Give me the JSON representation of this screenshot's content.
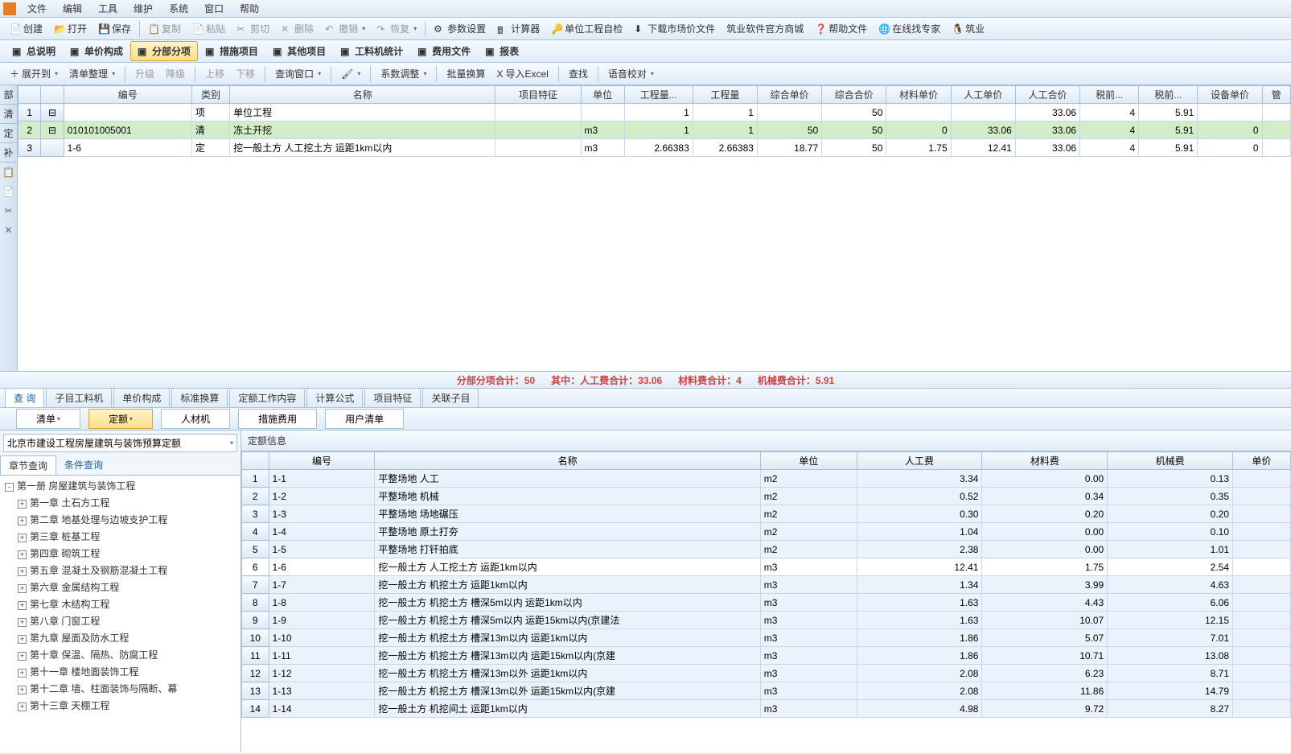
{
  "menu": [
    "文件",
    "编辑",
    "工具",
    "维护",
    "系统",
    "窗口",
    "帮助"
  ],
  "toolbar1": [
    {
      "label": "创建",
      "icon": "new"
    },
    {
      "label": "打开",
      "icon": "open"
    },
    {
      "label": "保存",
      "icon": "save"
    },
    {
      "sep": true
    },
    {
      "label": "复制",
      "icon": "copy",
      "disabled": true
    },
    {
      "label": "粘贴",
      "icon": "paste",
      "disabled": true
    },
    {
      "label": "剪切",
      "icon": "cut",
      "disabled": true
    },
    {
      "label": "删除",
      "icon": "del",
      "disabled": true
    },
    {
      "label": "撤销",
      "icon": "undo",
      "disabled": true,
      "dd": true
    },
    {
      "label": "恢复",
      "icon": "redo",
      "disabled": true,
      "dd": true
    },
    {
      "sep": true
    },
    {
      "label": "参数设置",
      "icon": "cfg"
    },
    {
      "label": "计算器",
      "icon": "calc"
    },
    {
      "label": "单位工程自检",
      "icon": "check"
    },
    {
      "label": "下载市场价文件",
      "icon": "dl"
    },
    {
      "label": "筑业软件官方商城"
    },
    {
      "label": "帮助文件",
      "icon": "help"
    },
    {
      "label": "在线找专家",
      "icon": "expert"
    },
    {
      "label": "筑业",
      "icon": "qq"
    }
  ],
  "tabs": [
    {
      "label": "总说明"
    },
    {
      "label": "单价构成"
    },
    {
      "label": "分部分项",
      "active": true
    },
    {
      "label": "措施项目"
    },
    {
      "label": "其他项目"
    },
    {
      "label": "工料机统计"
    },
    {
      "label": "费用文件"
    },
    {
      "label": "报表"
    }
  ],
  "subtoolbar": [
    {
      "label": "展开到",
      "icon": "plus",
      "dd": true
    },
    {
      "label": "清单整理",
      "dd": true
    },
    {
      "sep": true
    },
    {
      "label": "升级",
      "disabled": true
    },
    {
      "label": "降级",
      "disabled": true
    },
    {
      "sep": true
    },
    {
      "label": "上移",
      "disabled": true
    },
    {
      "label": "下移",
      "disabled": true
    },
    {
      "sep": true
    },
    {
      "label": "查询窗口",
      "dd": true
    },
    {
      "sep": true
    },
    {
      "label": "",
      "icon": "brush",
      "dd": true
    },
    {
      "sep": true
    },
    {
      "label": "系数调整",
      "dd": true
    },
    {
      "sep": true
    },
    {
      "label": "批量换算"
    },
    {
      "label": "导入Excel",
      "icon": "excel"
    },
    {
      "sep": true
    },
    {
      "label": "查找"
    },
    {
      "sep": true
    },
    {
      "label": "语音校对",
      "dd": true
    }
  ],
  "side_tabs": [
    "部",
    "清",
    "定",
    "补"
  ],
  "grid": {
    "headers": [
      "",
      "",
      "编号",
      "类别",
      "名称",
      "项目特征",
      "单位",
      "工程量...",
      "工程量",
      "综合单价",
      "综合合价",
      "材料单价",
      "人工单价",
      "人工合价",
      "税前...",
      "税前...",
      "设备单价",
      "管"
    ],
    "rows": [
      {
        "n": "1",
        "exp": "-",
        "code": "",
        "cat": "项",
        "name": "单位工程",
        "feat": "",
        "unit": "",
        "q1": "1",
        "q2": "1",
        "up": "",
        "hp": "50",
        "mp": "",
        "lp": "",
        "lh": "33.06",
        "t1": "4",
        "t2": "5.91",
        "ep": ""
      },
      {
        "n": "2",
        "exp": "-",
        "code": "010101005001",
        "cat": "清",
        "name": "冻土开挖",
        "feat": "",
        "unit": "m3",
        "q1": "1",
        "q2": "1",
        "up": "50",
        "hp": "50",
        "mp": "0",
        "lp": "33.06",
        "lh": "33.06",
        "t1": "4",
        "t2": "5.91",
        "ep": "0",
        "green": true
      },
      {
        "n": "3",
        "exp": "",
        "code": "1-6",
        "cat": "定",
        "name": "挖一般土方  人工挖土方  运距1km以内",
        "feat": "",
        "unit": "m3",
        "q1": "2.66383",
        "q2": "2.66383",
        "up": "18.77",
        "hp": "50",
        "mp": "1.75",
        "lp": "12.41",
        "lh": "33.06",
        "t1": "4",
        "t2": "5.91",
        "ep": "0"
      }
    ]
  },
  "status": {
    "sum": "分部分项合计：50",
    "labor": "其中：人工费合计：33.06",
    "mat": "材料费合计：4",
    "mach": "机械费合计：5.91"
  },
  "bottom_tabs": [
    "查 询",
    "子目工料机",
    "单价构成",
    "标准换算",
    "定额工作内容",
    "计算公式",
    "项目特征",
    "关联子目"
  ],
  "filter_buttons": [
    {
      "label": "清单",
      "dd": true
    },
    {
      "label": "定额",
      "active": true,
      "dd": true
    },
    {
      "label": "人材机"
    },
    {
      "label": "措施费用"
    },
    {
      "label": "用户清单"
    }
  ],
  "left": {
    "combo": "北京市建设工程房屋建筑与装饰预算定额",
    "subtabs": [
      "章节查询",
      "条件查询"
    ],
    "tree": [
      {
        "lvl": 0,
        "exp": "-",
        "label": "第一册  房屋建筑与装饰工程"
      },
      {
        "lvl": 1,
        "exp": "+",
        "label": "第一章  土石方工程"
      },
      {
        "lvl": 1,
        "exp": "+",
        "label": "第二章  地基处理与边坡支护工程"
      },
      {
        "lvl": 1,
        "exp": "+",
        "label": "第三章  桩基工程"
      },
      {
        "lvl": 1,
        "exp": "+",
        "label": "第四章  砌筑工程"
      },
      {
        "lvl": 1,
        "exp": "+",
        "label": "第五章  混凝土及钢筋混凝土工程"
      },
      {
        "lvl": 1,
        "exp": "+",
        "label": "第六章  金属结构工程"
      },
      {
        "lvl": 1,
        "exp": "+",
        "label": "第七章  木结构工程"
      },
      {
        "lvl": 1,
        "exp": "+",
        "label": "第八章  门窗工程"
      },
      {
        "lvl": 1,
        "exp": "+",
        "label": "第九章  屋面及防水工程"
      },
      {
        "lvl": 1,
        "exp": "+",
        "label": "第十章  保温、隔热、防腐工程"
      },
      {
        "lvl": 1,
        "exp": "+",
        "label": "第十一章  楼地面装饰工程"
      },
      {
        "lvl": 1,
        "exp": "+",
        "label": "第十二章  墙、柱面装饰与隔断、幕"
      },
      {
        "lvl": 1,
        "exp": "+",
        "label": "第十三章  天棚工程"
      }
    ]
  },
  "right": {
    "title": "定额信息",
    "headers": [
      "",
      "编号",
      "名称",
      "单位",
      "人工费",
      "材料费",
      "机械费",
      "单价"
    ],
    "rows": [
      {
        "n": "1",
        "code": "1-1",
        "name": "平整场地  人工",
        "unit": "m2",
        "l": "3.34",
        "m": "0.00",
        "j": "0.13",
        "p": ""
      },
      {
        "n": "2",
        "code": "1-2",
        "name": "平整场地  机械",
        "unit": "m2",
        "l": "0.52",
        "m": "0.34",
        "j": "0.35",
        "p": ""
      },
      {
        "n": "3",
        "code": "1-3",
        "name": "平整场地  场地碾压",
        "unit": "m2",
        "l": "0.30",
        "m": "0.20",
        "j": "0.20",
        "p": ""
      },
      {
        "n": "4",
        "code": "1-4",
        "name": "平整场地  原土打夯",
        "unit": "m2",
        "l": "1.04",
        "m": "0.00",
        "j": "0.10",
        "p": ""
      },
      {
        "n": "5",
        "code": "1-5",
        "name": "平整场地  打钎拍底",
        "unit": "m2",
        "l": "2.38",
        "m": "0.00",
        "j": "1.01",
        "p": ""
      },
      {
        "n": "6",
        "code": "1-6",
        "name": "挖一般土方  人工挖土方  运距1km以内",
        "unit": "m3",
        "l": "12.41",
        "m": "1.75",
        "j": "2.54",
        "p": "",
        "sel": true
      },
      {
        "n": "7",
        "code": "1-7",
        "name": "挖一般土方  机挖土方  运距1km以内",
        "unit": "m3",
        "l": "1.34",
        "m": "3.99",
        "j": "4.63",
        "p": ""
      },
      {
        "n": "8",
        "code": "1-8",
        "name": "挖一般土方  机挖土方  槽深5m以内  运距1km以内",
        "unit": "m3",
        "l": "1.63",
        "m": "4.43",
        "j": "6.06",
        "p": ""
      },
      {
        "n": "9",
        "code": "1-9",
        "name": "挖一般土方  机挖土方  槽深5m以内  运距15km以内(京建法",
        "unit": "m3",
        "l": "1.63",
        "m": "10.07",
        "j": "12.15",
        "p": ""
      },
      {
        "n": "10",
        "code": "1-10",
        "name": "挖一般土方  机挖土方  槽深13m以内  运距1km以内",
        "unit": "m3",
        "l": "1.86",
        "m": "5.07",
        "j": "7.01",
        "p": ""
      },
      {
        "n": "11",
        "code": "1-11",
        "name": "挖一般土方  机挖土方  槽深13m以内  运距15km以内(京建",
        "unit": "m3",
        "l": "1.86",
        "m": "10.71",
        "j": "13.08",
        "p": ""
      },
      {
        "n": "12",
        "code": "1-12",
        "name": "挖一般土方  机挖土方  槽深13m以外  运距1km以内",
        "unit": "m3",
        "l": "2.08",
        "m": "6.23",
        "j": "8.71",
        "p": ""
      },
      {
        "n": "13",
        "code": "1-13",
        "name": "挖一般土方  机挖土方  槽深13m以外  运距15km以内(京建",
        "unit": "m3",
        "l": "2.08",
        "m": "11.86",
        "j": "14.79",
        "p": ""
      },
      {
        "n": "14",
        "code": "1-14",
        "name": "挖一般土方  机挖间土  运距1km以内",
        "unit": "m3",
        "l": "4.98",
        "m": "9.72",
        "j": "8.27",
        "p": ""
      }
    ]
  }
}
